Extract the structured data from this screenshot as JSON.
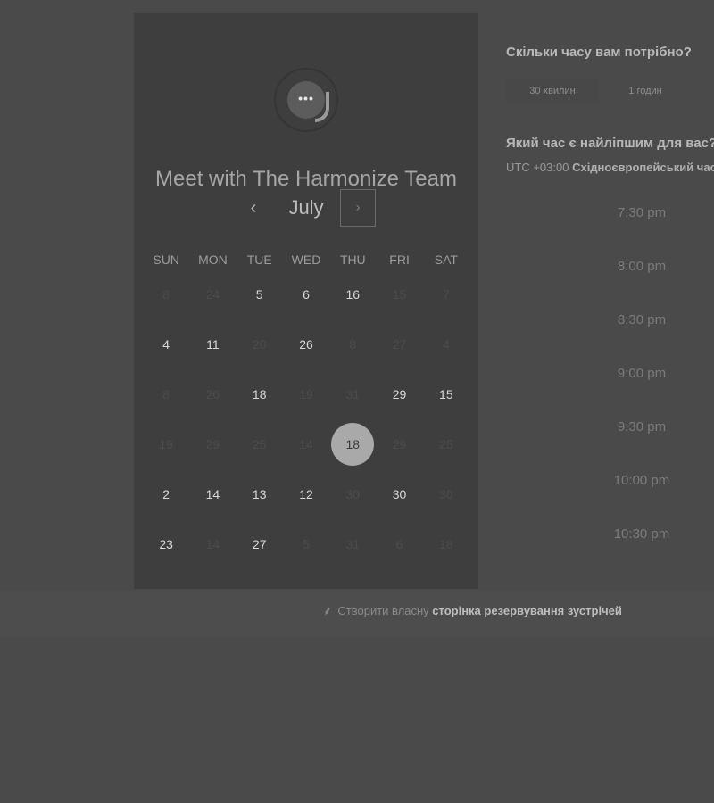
{
  "calendar": {
    "title": "Meet with The Harmonize Team",
    "month": "July",
    "prev_symbol": "‹",
    "next_symbol": "›",
    "weekdays": [
      "SUN",
      "MON",
      "TUE",
      "WED",
      "THU",
      "FRI",
      "SAT"
    ],
    "days": [
      {
        "n": "8",
        "available": false
      },
      {
        "n": "24",
        "available": false
      },
      {
        "n": "5",
        "available": true
      },
      {
        "n": "6",
        "available": true
      },
      {
        "n": "16",
        "available": true
      },
      {
        "n": "15",
        "available": false
      },
      {
        "n": "7",
        "available": false
      },
      {
        "n": "4",
        "available": true
      },
      {
        "n": "11",
        "available": true
      },
      {
        "n": "20",
        "available": false
      },
      {
        "n": "26",
        "available": true
      },
      {
        "n": "8",
        "available": false
      },
      {
        "n": "27",
        "available": false
      },
      {
        "n": "4",
        "available": false
      },
      {
        "n": "8",
        "available": false
      },
      {
        "n": "20",
        "available": false
      },
      {
        "n": "18",
        "available": true
      },
      {
        "n": "19",
        "available": false
      },
      {
        "n": "31",
        "available": false
      },
      {
        "n": "29",
        "available": true
      },
      {
        "n": "15",
        "available": true
      },
      {
        "n": "19",
        "available": false
      },
      {
        "n": "29",
        "available": false
      },
      {
        "n": "25",
        "available": false
      },
      {
        "n": "14",
        "available": false
      },
      {
        "n": "18",
        "available": true,
        "selected": true
      },
      {
        "n": "29",
        "available": false
      },
      {
        "n": "25",
        "available": false
      },
      {
        "n": "2",
        "available": true
      },
      {
        "n": "14",
        "available": true
      },
      {
        "n": "13",
        "available": true
      },
      {
        "n": "12",
        "available": true
      },
      {
        "n": "30",
        "available": false
      },
      {
        "n": "30",
        "available": true
      },
      {
        "n": "30",
        "available": false
      },
      {
        "n": "23",
        "available": true
      },
      {
        "n": "14",
        "available": false
      },
      {
        "n": "27",
        "available": true
      },
      {
        "n": "5",
        "available": false
      },
      {
        "n": "31",
        "available": false
      },
      {
        "n": "6",
        "available": false
      },
      {
        "n": "18",
        "available": false
      }
    ]
  },
  "booking": {
    "duration_question": "Скільки часу вам потрібно?",
    "durations": [
      "30 хвилин",
      "1 годин"
    ],
    "selected_duration": "30 хвилин",
    "time_question": "Який час є найліпшим для вас?",
    "tz_offset": "UTC +03:00",
    "tz_name": "Східноєвропейський час",
    "slots": [
      "7:30 pm",
      "8:00 pm",
      "8:30 pm",
      "9:00 pm",
      "9:30 pm",
      "10:00 pm",
      "10:30 pm"
    ]
  },
  "footer": {
    "prefix": "Створити власну",
    "link_text": "сторінка резервування зустрічей",
    "icon": "leaf-icon"
  }
}
